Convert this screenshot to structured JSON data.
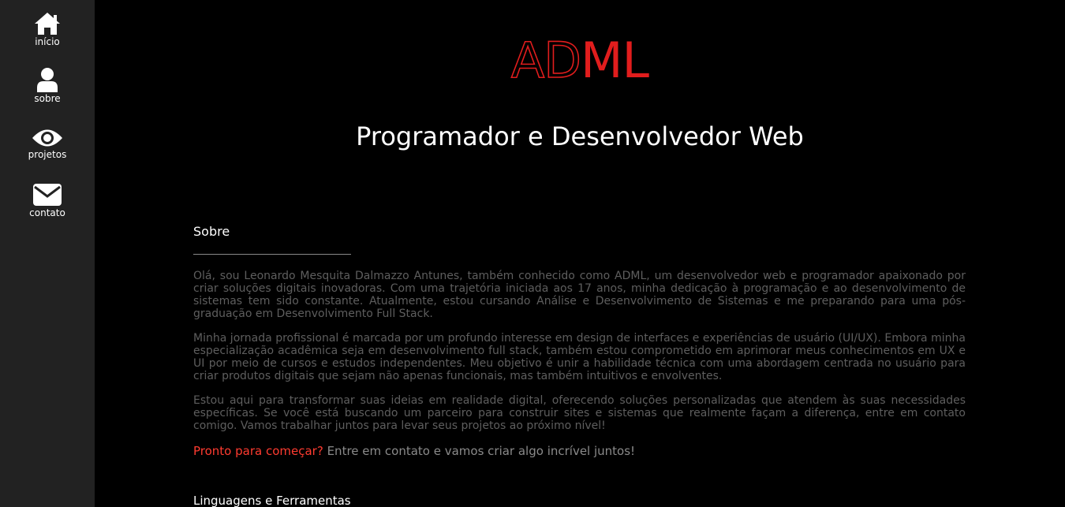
{
  "sidebar": {
    "items": [
      {
        "label": "início",
        "icon": "home-icon"
      },
      {
        "label": "sobre",
        "icon": "user-icon"
      },
      {
        "label": "projetos",
        "icon": "eye-icon"
      },
      {
        "label": "contato",
        "icon": "envelope-icon"
      }
    ]
  },
  "header": {
    "logo_outline": "AD",
    "logo_solid": "ML",
    "subtitle": "Programador e Desenvolvedor Web"
  },
  "about": {
    "title": "Sobre",
    "paragraphs": [
      "Olá, sou Leonardo Mesquita Dalmazzo Antunes, também conhecido como ADML, um desenvolvedor web e programador apaixonado por criar soluções digitais inovadoras. Com uma trajetória iniciada aos 17 anos, minha dedicação à programação e ao desenvolvimento de sistemas tem sido constante. Atualmente, estou cursando Análise e Desenvolvimento de Sistemas e me preparando para uma pós-graduação em Desenvolvimento Full Stack.",
      "Minha jornada profissional é marcada por um profundo interesse em design de interfaces e experiências de usuário (UI/UX). Embora minha especialização acadêmica seja em desenvolvimento full stack, também estou comprometido em aprimorar meus conhecimentos em UX e UI por meio de cursos e estudos independentes. Meu objetivo é unir a habilidade técnica com uma abordagem centrada no usuário para criar produtos digitais que sejam não apenas funcionais, mas também intuitivos e envolventes.",
      "Estou aqui para transformar suas ideias em realidade digital, oferecendo soluções personalizadas que atendem às suas necessidades específicas. Se você está buscando um parceiro para construir sites e sistemas que realmente façam a diferença, entre em contato comigo. Vamos trabalhar juntos para levar seus projetos ao próximo nível!"
    ],
    "cta_highlight": "Pronto para começar?",
    "cta_text": " Entre em contato e vamos criar algo incrível juntos!"
  },
  "languages": {
    "title": "Linguagens e Ferramentas"
  },
  "colors": {
    "accent": "#e11d1d",
    "sidebar_bg": "#222222",
    "background": "#000000",
    "body_text": "#5e5e5e"
  }
}
